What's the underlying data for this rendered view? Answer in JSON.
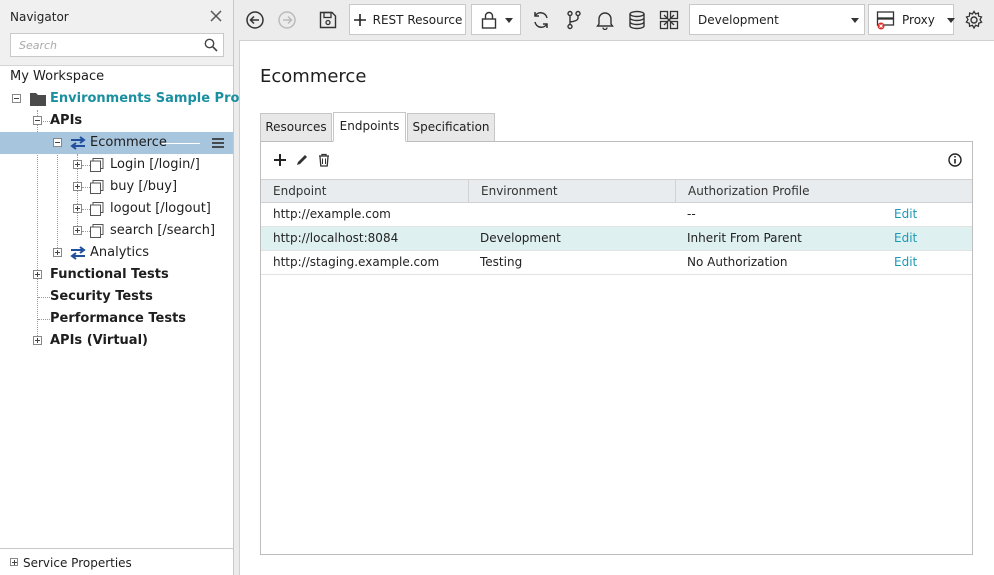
{
  "navigator": {
    "title": "Navigator",
    "search_placeholder": "Search",
    "workspace": "My Workspace",
    "project": "Environments Sample Project",
    "apis": "APIs",
    "ecommerce": "Ecommerce",
    "resources": [
      "Login [/login/]",
      "buy [/buy]",
      "logout [/logout]",
      "search [/search]"
    ],
    "analytics": "Analytics",
    "functional_tests": "Functional Tests",
    "security_tests": "Security Tests",
    "performance_tests": "Performance Tests",
    "apis_virtual": "APIs (Virtual)",
    "footer": "Service Properties"
  },
  "toolbar": {
    "rest_resource": "REST Resource",
    "environment": "Development",
    "proxy": "Proxy"
  },
  "main": {
    "title": "Ecommerce",
    "tabs": [
      "Resources",
      "Endpoints",
      "Specification"
    ],
    "active_tab": "Endpoints",
    "columns": [
      "Endpoint",
      "Environment",
      "Authorization Profile"
    ],
    "rows": [
      {
        "endpoint": "http://example.com",
        "environment": "",
        "auth": "--",
        "action": "Edit"
      },
      {
        "endpoint": "http://localhost:8084",
        "environment": "Development",
        "auth": "Inherit From Parent",
        "action": "Edit"
      },
      {
        "endpoint": "http://staging.example.com",
        "environment": "Testing",
        "auth": "No Authorization",
        "action": "Edit"
      }
    ]
  },
  "colors": {
    "accent": "#1a8fa0",
    "selection": "#a7c5dd",
    "row_highlight": "#dff0f0",
    "link": "#1a9ab5"
  }
}
